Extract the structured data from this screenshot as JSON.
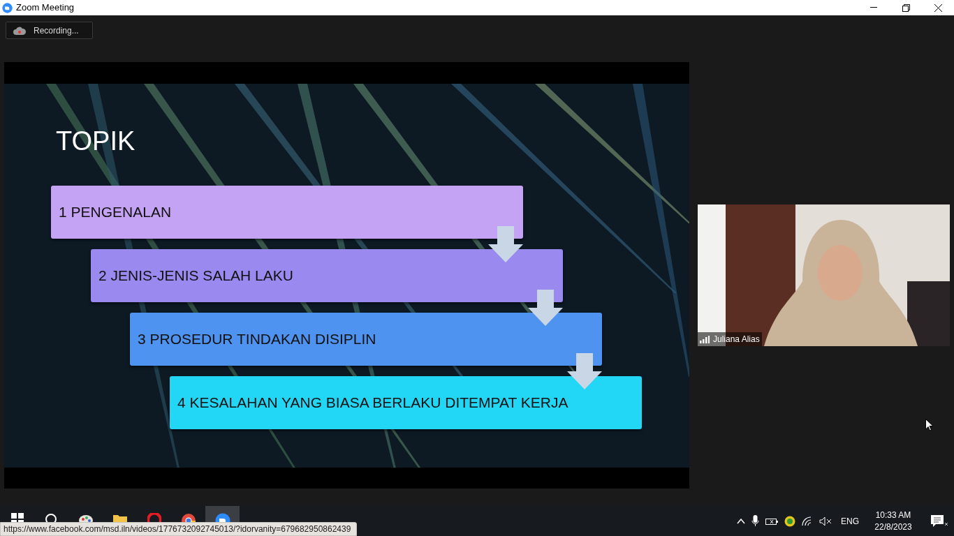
{
  "window": {
    "title": "Zoom Meeting"
  },
  "recording": {
    "label": "Recording..."
  },
  "slide": {
    "title": "TOPIK",
    "topics": [
      {
        "label": "1 PENGENALAN",
        "color": "#c4a2f4"
      },
      {
        "label": "2 JENIS-JENIS SALAH LAKU",
        "color": "#9a8af0"
      },
      {
        "label": "3 PROSEDUR TINDAKAN DISIPLIN",
        "color": "#4f93f0"
      },
      {
        "label": "4 KESALAHAN YANG BIASA BERLAKU DITEMPAT KERJA",
        "color": "#22d6f6"
      }
    ]
  },
  "participant": {
    "name": "Juliana Alias"
  },
  "taskbar": {
    "apps": [
      {
        "kind": "windows",
        "selected": false
      },
      {
        "kind": "search",
        "selected": false
      },
      {
        "kind": "paint",
        "selected": false
      },
      {
        "kind": "folder",
        "selected": false
      },
      {
        "kind": "opera",
        "selected": false
      },
      {
        "kind": "chrome",
        "selected": false
      },
      {
        "kind": "zoom",
        "selected": true
      }
    ],
    "language": "ENG",
    "time": "10:33 AM",
    "date": "22/8/2023"
  },
  "link_tooltip": "https://www.facebook.com/msd.iln/videos/1776732092745013/?idorvanity=679682950862439"
}
